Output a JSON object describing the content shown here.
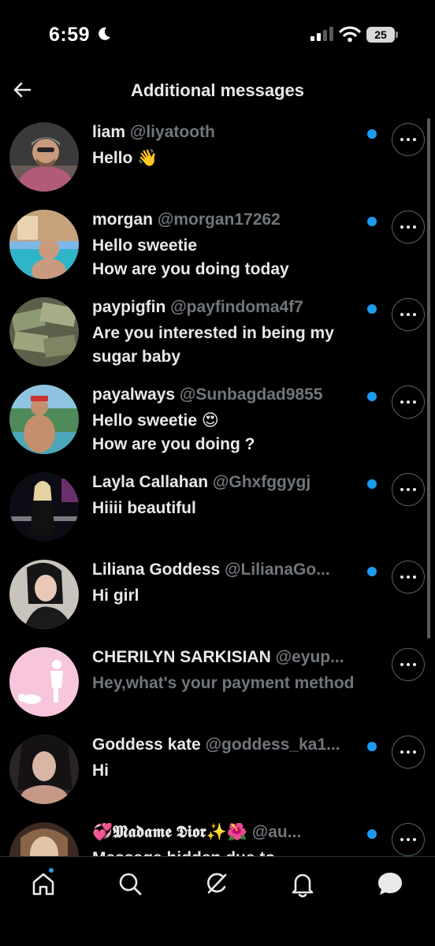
{
  "status": {
    "time": "6:59",
    "battery": "25"
  },
  "header": {
    "title": "Additional messages"
  },
  "colors": {
    "accent": "#1d9bf0",
    "background": "#000000",
    "text": "#e7e9ea",
    "muted": "#71767b"
  },
  "messages": [
    {
      "name": "liam",
      "handle": "@liyatooth",
      "text": "Hello 👋",
      "unread": true
    },
    {
      "name": "morgan",
      "handle": "@morgan17262",
      "text": "Hello sweetie\nHow are you doing today",
      "unread": true
    },
    {
      "name": "paypigfin",
      "handle": "@payfindoma4f7",
      "text": "Are you interested in being my sugar baby",
      "unread": true
    },
    {
      "name": "payalways",
      "handle": "@Sunbagdad9855",
      "text": "Hello sweetie 😍\nHow are you doing ?",
      "unread": true
    },
    {
      "name": "Layla Callahan",
      "handle": "@Ghxfggygj",
      "text": "Hiiii beautiful",
      "unread": true
    },
    {
      "name": "Liliana Goddess",
      "handle": "@LilianaGo...",
      "text": "Hi girl",
      "unread": true
    },
    {
      "name": "CHERILYN SARKISIAN",
      "handle": "@eyup...",
      "text": "Hey,what's your payment method",
      "unread": false
    },
    {
      "name": "Goddess kate",
      "handle": "@goddess_ka1...",
      "text": "Hi",
      "unread": true
    },
    {
      "name": "💞𝕸𝖆𝖉𝖆𝖒𝖊 𝕯𝖎𝖔𝖗✨🌺",
      "handle": "@au...",
      "text": "Message hidden due to",
      "unread": true
    }
  ],
  "tabs": [
    "home-tab",
    "search-tab",
    "grok-tab",
    "notifications-tab",
    "messages-tab"
  ]
}
